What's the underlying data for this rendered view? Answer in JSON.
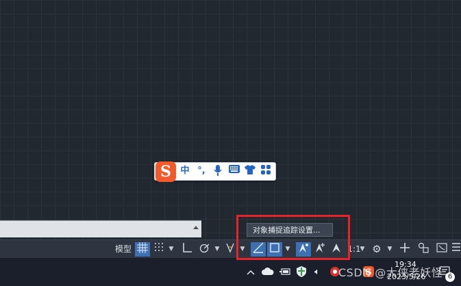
{
  "ime_bar": {
    "logo": "S",
    "chinese_mode": "中",
    "punctuation": "°,"
  },
  "tooltip": {
    "text": "对象捕捉追踪设置..."
  },
  "status_bar": {
    "model_label": "模型",
    "scale_label": "1:1"
  },
  "taskbar": {
    "time": "19:34",
    "date": "2023/5/26",
    "notification_count": "6",
    "watermark": "CSDN @大侠老妖怪"
  },
  "colors": {
    "highlight_box": "#e8232a",
    "active_toggle": "#3d6fb3",
    "sogou_brand": "#f25a2b"
  }
}
